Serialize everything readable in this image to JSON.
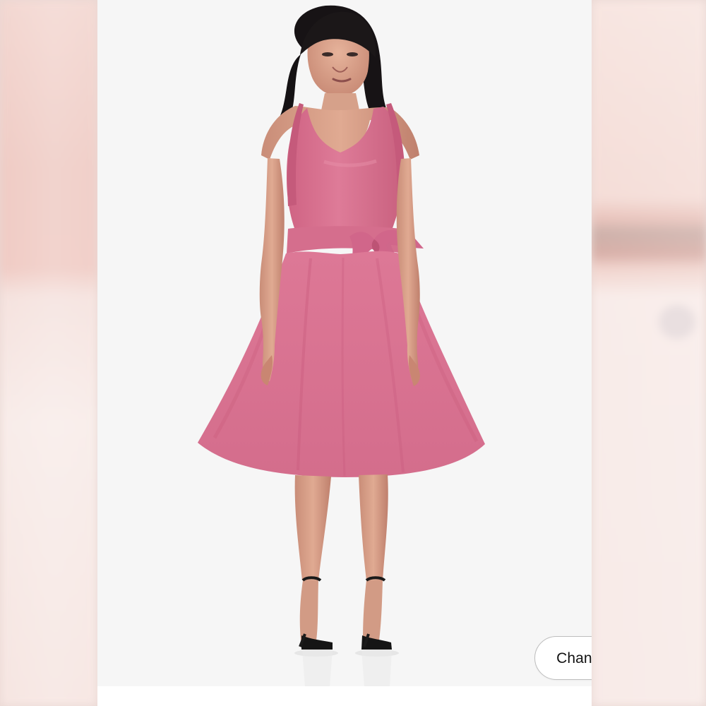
{
  "actions": {
    "change_model_label": "Change model"
  },
  "product_preview": {
    "image_subject": "model-wearing-pink-dress",
    "dress_color": "#d86f8e",
    "background_color": "#f6f6f6"
  },
  "icons": {
    "change_model": "button"
  }
}
